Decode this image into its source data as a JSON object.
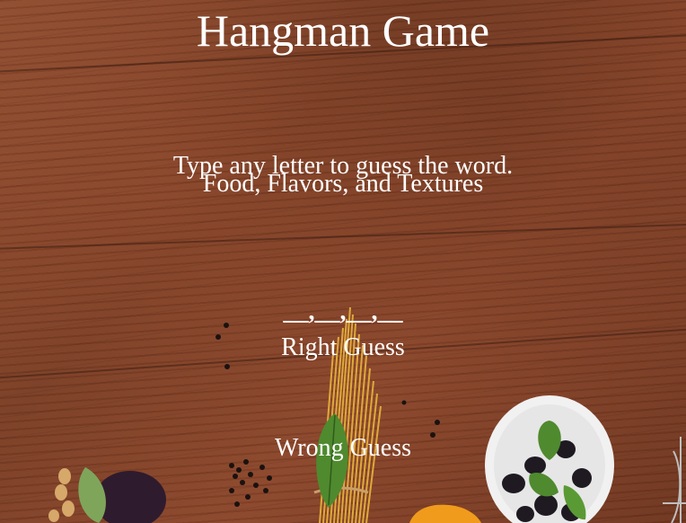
{
  "header": {
    "title": "Hangman Game"
  },
  "game": {
    "instruction": "Type any letter to guess the word.",
    "category": "Food, Flavors, and Textures",
    "word_display": "__,__,__,__",
    "right_guess_label": "Right Guess",
    "wrong_guess_label": "Wrong Guess"
  },
  "background": {
    "description_icons": [
      "wood-table-texture",
      "spaghetti-bundle",
      "basil-leaf",
      "olive-bowl",
      "black-peppercorns",
      "eggplant",
      "pasta-shells",
      "orange"
    ]
  },
  "colors": {
    "text": "#ffffff",
    "wood": "#7a3f27",
    "wood_dark": "#5a2c18",
    "pasta": "#e0a93a",
    "basil": "#4f8a2e",
    "olive": "#1f1a22",
    "plate": "#f1f1f1",
    "orange": "#f19b1c",
    "eggplant": "#2f1b2e"
  }
}
